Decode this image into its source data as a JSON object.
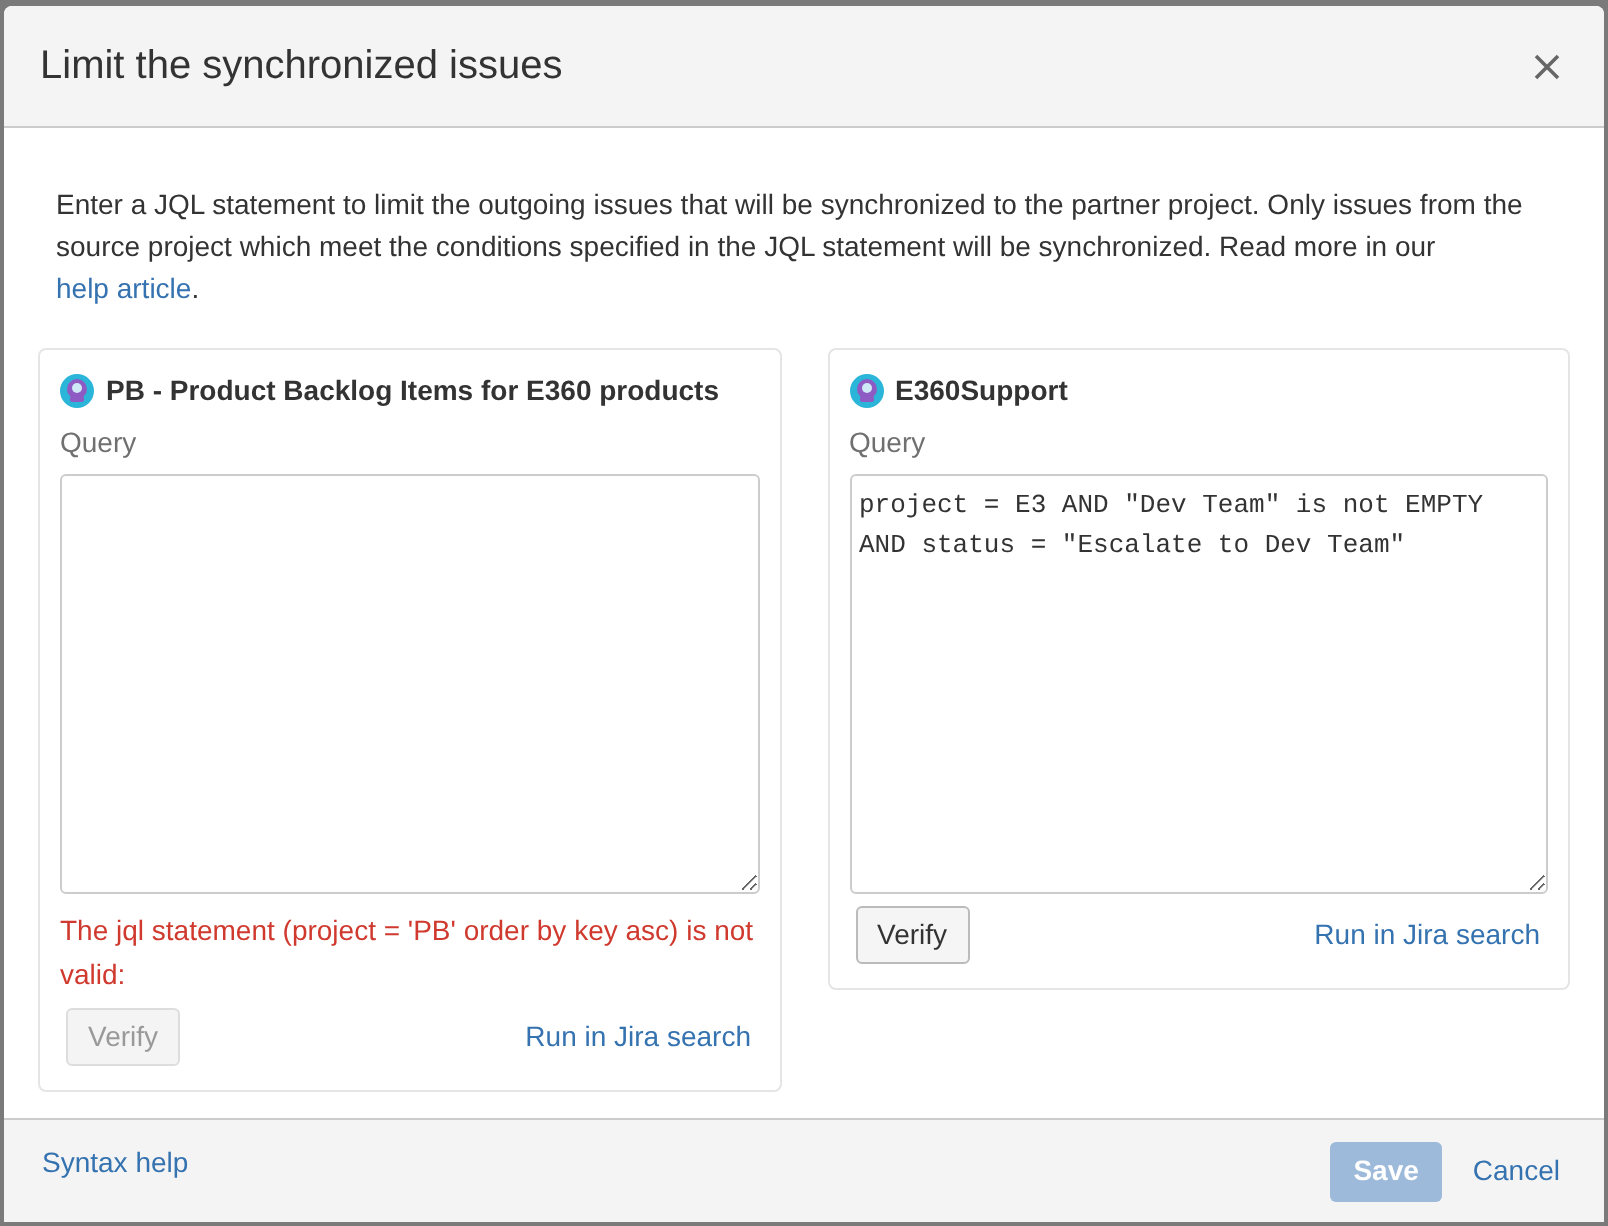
{
  "dialog": {
    "title": "Limit the synchronized issues",
    "description": {
      "text": "Enter a JQL statement to limit the outgoing issues that will be synchronized to the partner project. Only issues from the source project which meet the conditions specified in the JQL statement will be synchronized. Read more in our",
      "link": "help article",
      "after": "."
    }
  },
  "panels": [
    {
      "title": "PB - Product Backlog Items for E360 products",
      "label": "Query",
      "error": "The jql statement (project = 'PB' order by key asc) is not valid:",
      "verify": {
        "label": "Verify",
        "disabled": true
      },
      "run_link": "Run in Jira search"
    },
    {
      "title": "E360Support",
      "label": "Query",
      "value": "project = E3 AND \"Dev Team\" is not EMPTY AND status = \"Escalate to Dev Team\"",
      "verify": {
        "label": "Verify",
        "disabled": false
      },
      "run_link": "Run in Jira search"
    }
  ],
  "footer": {
    "syntax_link": "Syntax help",
    "save": {
      "label": "Save",
      "disabled": true
    },
    "cancel": "Cancel"
  }
}
